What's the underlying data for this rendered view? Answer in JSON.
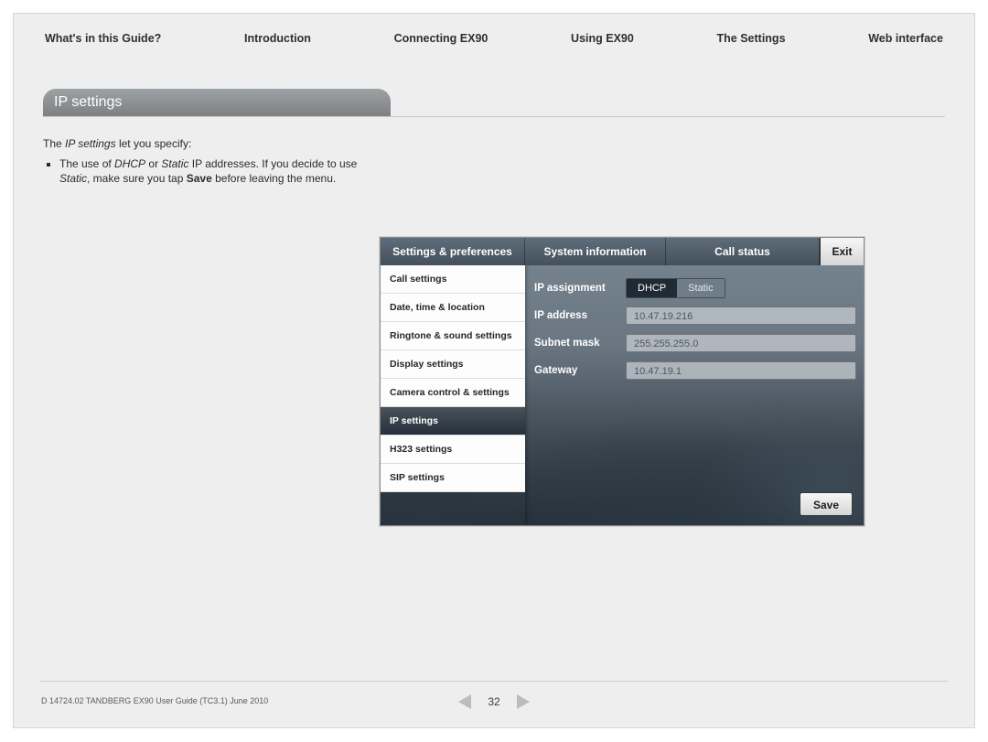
{
  "nav": {
    "items": [
      "What's in this Guide?",
      "Introduction",
      "Connecting EX90",
      "Using EX90",
      "The Settings",
      "Web interface"
    ]
  },
  "section": {
    "title": "IP settings"
  },
  "body": {
    "intro_pre": "The ",
    "intro_em": "IP settings",
    "intro_post": " let you specify:",
    "bullet_seg1": "The use of ",
    "bullet_em1": "DHCP",
    "bullet_seg2": " or ",
    "bullet_em2": "Static",
    "bullet_seg3": " IP addresses. If you decide to use ",
    "bullet_em3": "Static",
    "bullet_seg4": ", make sure you tap ",
    "bullet_bold": "Save",
    "bullet_seg5": " before leaving the menu."
  },
  "device": {
    "tabs": {
      "pref": "Settings & preferences",
      "sys": "System information",
      "call": "Call status",
      "exit": "Exit"
    },
    "side": [
      "Call settings",
      "Date, time & location",
      "Ringtone & sound settings",
      "Display settings",
      "Camera control & settings",
      "IP settings",
      "H323 settings",
      "SIP settings"
    ],
    "panel": {
      "assign_label": "IP assignment",
      "assign_opts": [
        "DHCP",
        "Static"
      ],
      "ipaddr_label": "IP address",
      "ipaddr_value": "10.47.19.216",
      "subnet_label": "Subnet mask",
      "subnet_value": "255.255.255.0",
      "gateway_label": "Gateway",
      "gateway_value": "10.47.19.1",
      "save": "Save"
    }
  },
  "footer": {
    "left": "D 14724.02 TANDBERG EX90 User Guide (TC3.1) June 2010",
    "page": "32"
  }
}
